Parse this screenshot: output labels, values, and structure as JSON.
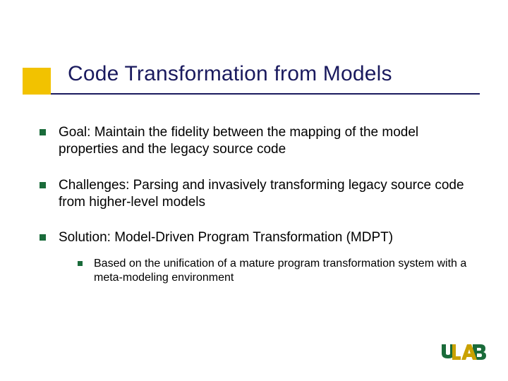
{
  "title": "Code Transformation from Models",
  "bullets": [
    {
      "text": "Goal: Maintain the fidelity between the mapping of the model properties and the legacy source code"
    },
    {
      "text": "Challenges: Parsing and invasively transforming legacy source code from higher-level models"
    },
    {
      "text": "Solution: Model-Driven Program Transformation (MDPT)"
    }
  ],
  "sub_bullets": [
    {
      "text": "Based on the unification of a mature program transformation system with a meta-modeling environment"
    }
  ],
  "logo_alt": "UAB"
}
